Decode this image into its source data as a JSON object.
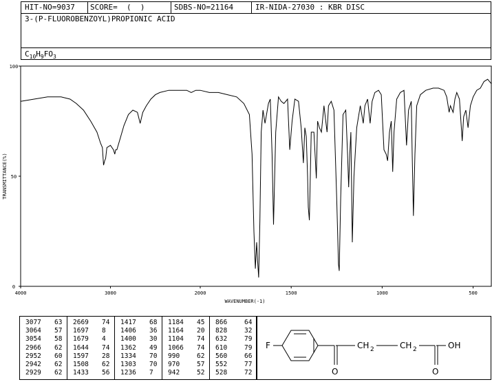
{
  "header": {
    "hit_no": "HIT-NO=9037",
    "score": "SCORE=  (  )",
    "sdbs_no": "SDBS-NO=21164",
    "ir_id": "IR-NIDA-27030 : KBR DISC",
    "compound": "3-(P-FLUOROBENZOYL)PROPIONIC ACID",
    "formula_main": "C",
    "formula_c": "10",
    "formula_h": "H",
    "formula_hn": "9",
    "formula_f": "FO",
    "formula_on": "3"
  },
  "chart_data": {
    "type": "line",
    "title": "",
    "xlabel": "WAVENUMBER(-1)",
    "ylabel": "TRANSMITTANCE(%)",
    "xlim": [
      4000,
      400
    ],
    "ylim": [
      0,
      100
    ],
    "x_ticks": [
      "4000",
      "3000",
      "2000",
      "1500",
      "1000",
      "500"
    ],
    "y_ticks": [
      "100",
      "50",
      "0"
    ],
    "series": [
      {
        "points": [
          [
            4000,
            84
          ],
          [
            3850,
            85
          ],
          [
            3700,
            86
          ],
          [
            3550,
            86
          ],
          [
            3450,
            85
          ],
          [
            3380,
            83
          ],
          [
            3300,
            80
          ],
          [
            3220,
            75
          ],
          [
            3150,
            70
          ],
          [
            3110,
            65
          ],
          [
            3090,
            63
          ],
          [
            3077,
            55
          ],
          [
            3064,
            57
          ],
          [
            3054,
            58
          ],
          [
            3040,
            63
          ],
          [
            3000,
            64
          ],
          [
            2966,
            62
          ],
          [
            2952,
            60
          ],
          [
            2942,
            62
          ],
          [
            2929,
            62
          ],
          [
            2900,
            66
          ],
          [
            2850,
            73
          ],
          [
            2800,
            78
          ],
          [
            2750,
            80
          ],
          [
            2700,
            79
          ],
          [
            2669,
            74
          ],
          [
            2640,
            79
          ],
          [
            2600,
            82
          ],
          [
            2550,
            85
          ],
          [
            2500,
            87
          ],
          [
            2450,
            88
          ],
          [
            2350,
            89
          ],
          [
            2250,
            89
          ],
          [
            2150,
            89
          ],
          [
            2100,
            88
          ],
          [
            2050,
            89
          ],
          [
            2000,
            89
          ],
          [
            1950,
            88
          ],
          [
            1900,
            88
          ],
          [
            1850,
            87
          ],
          [
            1800,
            86
          ],
          [
            1760,
            83
          ],
          [
            1730,
            78
          ],
          [
            1715,
            60
          ],
          [
            1705,
            25
          ],
          [
            1697,
            8
          ],
          [
            1690,
            20
          ],
          [
            1685,
            12
          ],
          [
            1679,
            4
          ],
          [
            1672,
            30
          ],
          [
            1665,
            70
          ],
          [
            1655,
            80
          ],
          [
            1644,
            74
          ],
          [
            1625,
            83
          ],
          [
            1615,
            85
          ],
          [
            1605,
            60
          ],
          [
            1597,
            28
          ],
          [
            1585,
            70
          ],
          [
            1570,
            86
          ],
          [
            1555,
            84
          ],
          [
            1540,
            83
          ],
          [
            1520,
            85
          ],
          [
            1508,
            62
          ],
          [
            1495,
            75
          ],
          [
            1480,
            85
          ],
          [
            1460,
            84
          ],
          [
            1445,
            72
          ],
          [
            1433,
            56
          ],
          [
            1425,
            72
          ],
          [
            1417,
            68
          ],
          [
            1410,
            50
          ],
          [
            1406,
            36
          ],
          [
            1400,
            30
          ],
          [
            1390,
            70
          ],
          [
            1375,
            70
          ],
          [
            1362,
            49
          ],
          [
            1355,
            75
          ],
          [
            1345,
            72
          ],
          [
            1334,
            70
          ],
          [
            1320,
            82
          ],
          [
            1310,
            75
          ],
          [
            1303,
            70
          ],
          [
            1295,
            82
          ],
          [
            1280,
            84
          ],
          [
            1265,
            80
          ],
          [
            1250,
            40
          ],
          [
            1240,
            10
          ],
          [
            1236,
            7
          ],
          [
            1228,
            40
          ],
          [
            1215,
            78
          ],
          [
            1200,
            80
          ],
          [
            1190,
            60
          ],
          [
            1184,
            45
          ],
          [
            1178,
            60
          ],
          [
            1172,
            70
          ],
          [
            1164,
            20
          ],
          [
            1155,
            50
          ],
          [
            1140,
            72
          ],
          [
            1120,
            82
          ],
          [
            1104,
            74
          ],
          [
            1095,
            82
          ],
          [
            1080,
            85
          ],
          [
            1066,
            74
          ],
          [
            1055,
            84
          ],
          [
            1040,
            88
          ],
          [
            1020,
            89
          ],
          [
            1005,
            87
          ],
          [
            990,
            62
          ],
          [
            978,
            60
          ],
          [
            970,
            57
          ],
          [
            960,
            70
          ],
          [
            950,
            75
          ],
          [
            942,
            52
          ],
          [
            935,
            70
          ],
          [
            920,
            85
          ],
          [
            900,
            88
          ],
          [
            880,
            89
          ],
          [
            866,
            64
          ],
          [
            855,
            80
          ],
          [
            840,
            84
          ],
          [
            835,
            60
          ],
          [
            828,
            32
          ],
          [
            820,
            60
          ],
          [
            810,
            82
          ],
          [
            790,
            87
          ],
          [
            760,
            89
          ],
          [
            720,
            90
          ],
          [
            690,
            90
          ],
          [
            660,
            89
          ],
          [
            645,
            86
          ],
          [
            632,
            79
          ],
          [
            625,
            82
          ],
          [
            610,
            79
          ],
          [
            600,
            85
          ],
          [
            590,
            88
          ],
          [
            575,
            85
          ],
          [
            560,
            66
          ],
          [
            552,
            77
          ],
          [
            540,
            80
          ],
          [
            528,
            72
          ],
          [
            515,
            82
          ],
          [
            500,
            86
          ],
          [
            480,
            89
          ],
          [
            460,
            90
          ],
          [
            440,
            93
          ],
          [
            420,
            94
          ],
          [
            400,
            92
          ]
        ]
      }
    ],
    "grid": false,
    "legend": "none"
  },
  "peaks": {
    "columns": [
      [
        [
          "3077",
          "63"
        ],
        [
          "3064",
          "57"
        ],
        [
          "3054",
          "58"
        ],
        [
          "2966",
          "62"
        ],
        [
          "2952",
          "60"
        ],
        [
          "2942",
          "62"
        ],
        [
          "2929",
          "62"
        ]
      ],
      [
        [
          "2669",
          "74"
        ],
        [
          "1697",
          "8"
        ],
        [
          "1679",
          "4"
        ],
        [
          "1644",
          "74"
        ],
        [
          "1597",
          "28"
        ],
        [
          "1508",
          "62"
        ],
        [
          "1433",
          "56"
        ]
      ],
      [
        [
          "1417",
          "68"
        ],
        [
          "1406",
          "36"
        ],
        [
          "1400",
          "30"
        ],
        [
          "1362",
          "49"
        ],
        [
          "1334",
          "70"
        ],
        [
          "1303",
          "70"
        ],
        [
          "1236",
          "7"
        ]
      ],
      [
        [
          "1184",
          "45"
        ],
        [
          "1164",
          "20"
        ],
        [
          "1104",
          "74"
        ],
        [
          "1066",
          "74"
        ],
        [
          "990",
          "62"
        ],
        [
          "970",
          "57"
        ],
        [
          "942",
          "52"
        ]
      ],
      [
        [
          "866",
          "64"
        ],
        [
          "828",
          "32"
        ],
        [
          "632",
          "79"
        ],
        [
          "610",
          "79"
        ],
        [
          "560",
          "66"
        ],
        [
          "552",
          "77"
        ],
        [
          "528",
          "72"
        ]
      ]
    ]
  },
  "structure": {
    "f_label": "F",
    "o1_label": "O",
    "ch2a": "CH",
    "ch2a_sub": "2",
    "ch2b": "CH",
    "ch2b_sub": "2",
    "oh_label": "OH",
    "o2_label": "O"
  }
}
